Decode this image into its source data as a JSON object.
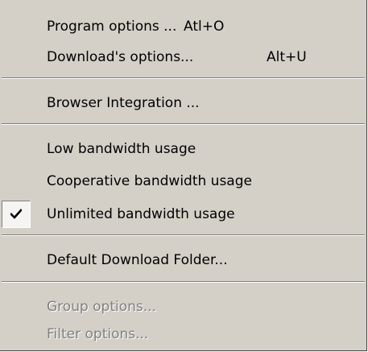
{
  "menu": {
    "items": [
      {
        "label": "Program options ... ",
        "shortcut": "Atl+O"
      },
      {
        "label": "Download's options...",
        "shortcut": "Alt+U"
      },
      {
        "label": "Browser Integration ..."
      },
      {
        "label": "Low bandwidth usage"
      },
      {
        "label": "Cooperative bandwidth usage"
      },
      {
        "label": "Unlimited bandwidth usage",
        "checked": true,
        "icon": "checkmark-icon"
      },
      {
        "label": "Default Download Folder..."
      },
      {
        "label": "Group options...",
        "disabled": true
      },
      {
        "label": "Filter options...",
        "disabled": true
      }
    ]
  }
}
